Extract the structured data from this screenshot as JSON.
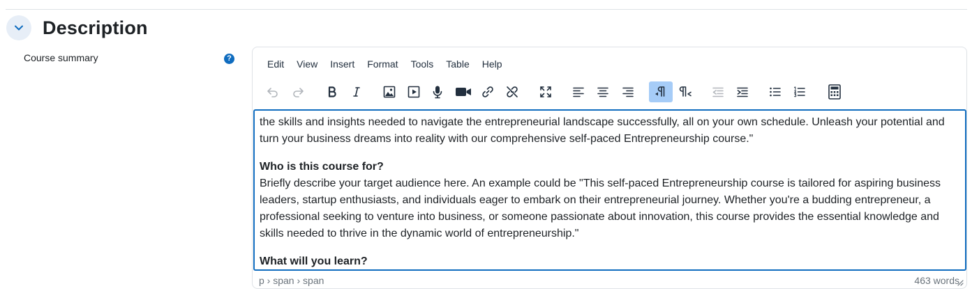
{
  "section": {
    "title": "Description",
    "collapse_icon": "chevron-down-icon"
  },
  "field": {
    "label": "Course summary",
    "help_icon": "question-circle-icon",
    "help_glyph": "?"
  },
  "editor": {
    "menu": [
      "Edit",
      "View",
      "Insert",
      "Format",
      "Tools",
      "Table",
      "Help"
    ],
    "toolbar": [
      {
        "name": "undo-icon",
        "state": "disabled"
      },
      {
        "name": "redo-icon",
        "state": "disabled"
      },
      {
        "name": "bold-icon",
        "state": "normal"
      },
      {
        "name": "italic-icon",
        "state": "normal"
      },
      {
        "name": "image-icon",
        "state": "normal"
      },
      {
        "name": "media-icon",
        "state": "normal"
      },
      {
        "name": "microphone-icon",
        "state": "normal"
      },
      {
        "name": "video-camera-icon",
        "state": "normal"
      },
      {
        "name": "link-icon",
        "state": "normal"
      },
      {
        "name": "unlink-icon",
        "state": "normal"
      },
      {
        "name": "fullscreen-icon",
        "state": "normal"
      },
      {
        "name": "align-left-icon",
        "state": "normal"
      },
      {
        "name": "align-center-icon",
        "state": "normal"
      },
      {
        "name": "align-right-icon",
        "state": "normal"
      },
      {
        "name": "ltr-icon",
        "state": "active"
      },
      {
        "name": "rtl-icon",
        "state": "normal"
      },
      {
        "name": "outdent-icon",
        "state": "disabled"
      },
      {
        "name": "indent-icon",
        "state": "normal"
      },
      {
        "name": "bullet-list-icon",
        "state": "normal"
      },
      {
        "name": "numbered-list-icon",
        "state": "normal"
      },
      {
        "name": "calculator-icon",
        "state": "normal"
      }
    ],
    "content": {
      "para1": "the skills and insights needed to navigate the entrepreneurial landscape successfully, all on your own schedule. Unleash your potential and turn your business dreams into reality with our comprehensive self-paced Entrepreneurship course.\"",
      "heading1": "Who is this course for?",
      "para2": "Briefly describe your target audience here. An example could be \"This self-paced Entrepreneurship course is tailored for aspiring business leaders, startup enthusiasts, and individuals eager to embark on their entrepreneurial journey. Whether you're a budding entrepreneur, a professional seeking to venture into business, or someone passionate about innovation, this course provides the essential knowledge and skills needed to thrive in the dynamic world of entrepreneurship.\"",
      "heading2": "What will you learn?"
    },
    "status": {
      "path": "p › span › span",
      "word_count": "463 words"
    }
  },
  "colors": {
    "accent": "#0f6cbf",
    "active_button": "#a6ccf7",
    "toolbar_icon": "#222f3e"
  }
}
